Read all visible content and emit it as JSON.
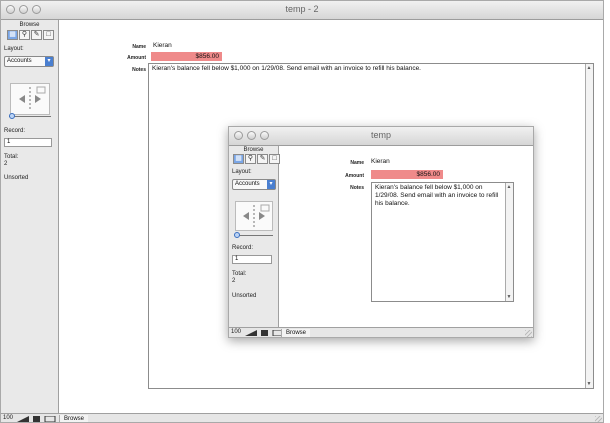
{
  "main_window": {
    "title": "temp - 2",
    "status": {
      "mode": "Browse",
      "layout_label": "Layout:",
      "layout_value": "Accounts",
      "record_label": "Record:",
      "record_value": "1",
      "total_label": "Total:",
      "total_value": "2",
      "sort_status": "Unsorted"
    },
    "fields": {
      "name_label": "Name",
      "name_value": "Kieran",
      "amount_label": "Amount",
      "amount_value": "$856.00",
      "notes_label": "Notes",
      "notes_value": "Kieran's balance fell below $1,000 on 1/29/08. Send email with an invoice to refill his balance."
    },
    "bottom": {
      "zoom": "100",
      "mode": "Browse"
    }
  },
  "inner_window": {
    "title": "temp",
    "status": {
      "mode": "Browse",
      "layout_label": "Layout:",
      "layout_value": "Accounts",
      "record_label": "Record:",
      "record_value": "1",
      "total_label": "Total:",
      "total_value": "2",
      "sort_status": "Unsorted"
    },
    "fields": {
      "name_label": "Name",
      "name_value": "Kieran",
      "amount_label": "Amount",
      "amount_value": "$856.00",
      "notes_label": "Notes",
      "notes_value": "Kieran's balance fell below $1,000 on 1/29/08. Send email with an invoice to refill his balance."
    },
    "bottom": {
      "zoom": "100",
      "mode": "Browse"
    }
  },
  "colors": {
    "amount_highlight": "#ef8a8a",
    "accent_blue": "#4a7fd0"
  },
  "icons": [
    "browse-mode-icon",
    "find-mode-icon",
    "layout-mode-icon",
    "preview-mode-icon",
    "record-book-icon",
    "popup-arrow-icon",
    "resize-grip-icon"
  ]
}
